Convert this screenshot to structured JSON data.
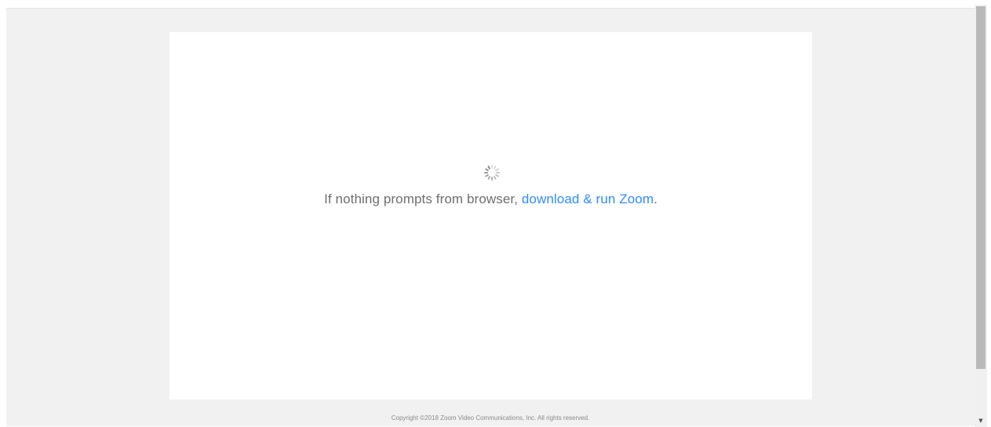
{
  "prompt": {
    "text_before": "If nothing prompts from browser, ",
    "link_text": "download & run Zoom",
    "text_after": "."
  },
  "footer": {
    "copyright": "Copyright ©2018 Zoom Video Communications, Inc. All rights reserved."
  },
  "icons": {
    "loading": "loading-spinner-icon",
    "scroll_down": "scroll-down-arrow-icon"
  },
  "colors": {
    "link": "#2d8cff",
    "text": "#6e6e6e",
    "page_background": "#f1f1f1",
    "card_background": "#ffffff"
  }
}
